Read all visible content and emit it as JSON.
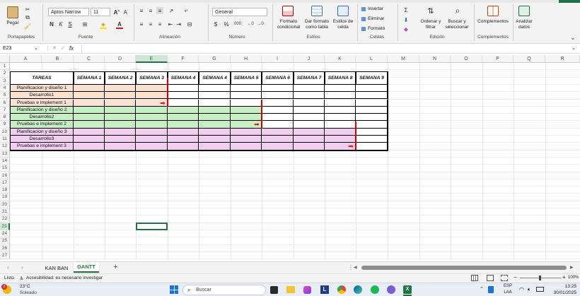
{
  "ribbon": {
    "paste": "Pegar",
    "font_name": "Aptos Narrow",
    "font_size": "11",
    "grow_font": "A^",
    "shrink_font": "A˅",
    "bold": "N",
    "italic": "K",
    "underline": "S",
    "number_format": "General",
    "currency": "$",
    "percent": "%",
    "thousands": "000",
    "cond_format": "Formato condicional",
    "table_format": "Dar formato como tabla",
    "cell_styles": "Estilos de celda",
    "insert": "Insertar",
    "delete": "Eliminar",
    "format": "Formato",
    "sort_filter": "Ordenar y filtrar",
    "find_select": "Buscar y seleccionar",
    "addins": "Complementos",
    "analyze": "Analizar datos",
    "groups": {
      "clipboard": "Portapapeles",
      "font": "Fuente",
      "alignment": "Alineación",
      "number": "Número",
      "styles": "Estilos",
      "cells": "Celdas",
      "editing": "Edición",
      "addins": "Complementos"
    }
  },
  "formula_bar": {
    "name_box": "E23",
    "fx": "fx",
    "content": ""
  },
  "columns": [
    "A",
    "B",
    "C",
    "D",
    "E",
    "F",
    "G",
    "H",
    "I",
    "J",
    "K",
    "L",
    "M",
    "N",
    "O",
    "P",
    "Q",
    "R"
  ],
  "rows": [
    "1",
    "2",
    "3",
    "4",
    "5",
    "6",
    "7",
    "8",
    "9",
    "10",
    "11",
    "12",
    "13",
    "14",
    "15",
    "16",
    "17",
    "18",
    "19",
    "20",
    "21",
    "22",
    "23",
    "24",
    "25",
    "26",
    "27"
  ],
  "table": {
    "headers": [
      "TAREAS",
      "SEMANA 1",
      "SEMANA 2",
      "SEMANA 3",
      "SEMANA 4",
      "SEMANA 4",
      "SEMANA 5",
      "SEMANA 6",
      "SEMANA 7",
      "SEMANA 8",
      "SEMANA 9"
    ],
    "tasks": [
      {
        "name": "Planificacion y diseño 1",
        "color": "#fbe1d0",
        "span": 3
      },
      {
        "name": "Desarrollo1",
        "color": "#fbe1d0",
        "span": 3
      },
      {
        "name": "Pruebas e implement 1",
        "color": "#fbe1d0",
        "span": 3,
        "arrow": true
      },
      {
        "name": "Planificacion y diseño 2",
        "color": "#c6efc4",
        "span": 6
      },
      {
        "name": "Desarrollo2",
        "color": "#c6efc4",
        "span": 6
      },
      {
        "name": "Pruebas e implement 2",
        "color": "#c6efc4",
        "span": 6,
        "arrow": true
      },
      {
        "name": "Planificacion y diseño 3",
        "color": "#f1cdef",
        "span": 9
      },
      {
        "name": "Desarrollo3",
        "color": "#f1cdef",
        "span": 9
      },
      {
        "name": "Pruebas e implement 3",
        "color": "#f1cdef",
        "span": 9,
        "arrow": true
      }
    ]
  },
  "sheet_tabs": [
    {
      "label": "KAN BAN",
      "active": false
    },
    {
      "label": "GANTT",
      "active": true
    }
  ],
  "add_sheet": "+",
  "status": {
    "ready": "Listo",
    "accessibility": "Accesibilidad: es necesario investigar",
    "zoom": "100%"
  },
  "taskbar": {
    "weather_temp": "23°C",
    "weather_desc": "Soleado",
    "notif_count": "2",
    "search": "Buscar",
    "lang": "ESP",
    "lang2": "LAA",
    "time": "13:25",
    "date": "30/01/2025"
  },
  "colors": {
    "accent_green": "#217346",
    "arrow_red": "#e21b1b",
    "progress_line": "#d40000"
  }
}
